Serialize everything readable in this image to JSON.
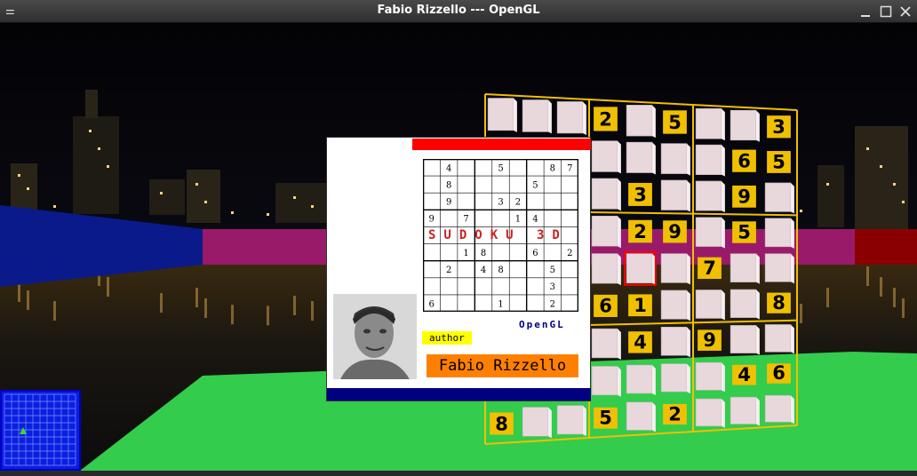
{
  "window": {
    "title": "Fabio Rizzello --- OpenGL",
    "menu_icon": "menu-icon",
    "controls": [
      "minimize-icon",
      "maximize-icon",
      "close-icon"
    ]
  },
  "splash": {
    "sudoku_title": "SUDOKU 3D",
    "opengl_label": "OpenGL",
    "author_label": "author",
    "author_name": "Fabio Rizzello",
    "grid": [
      [
        "",
        "4",
        "",
        "",
        "5",
        "",
        "",
        "8",
        "7"
      ],
      [
        "",
        "8",
        "",
        "",
        "",
        "",
        "5",
        "",
        ""
      ],
      [
        "",
        "9",
        "",
        "",
        "3",
        "2",
        "",
        "",
        ""
      ],
      [
        "9",
        "",
        "7",
        "",
        "",
        "1",
        "4",
        "",
        ""
      ],
      [
        "",
        "",
        "",
        "",
        "",
        "",
        "",
        "",
        ""
      ],
      [
        "",
        "",
        "1",
        "8",
        "",
        "",
        "6",
        "",
        "2"
      ],
      [
        "",
        "2",
        "",
        "4",
        "8",
        "",
        "",
        "5",
        ""
      ],
      [
        "",
        "",
        "",
        "",
        "",
        "",
        "",
        "3",
        ""
      ],
      [
        "6",
        "",
        "",
        "",
        "1",
        "",
        "",
        "2",
        ""
      ]
    ]
  },
  "board": {
    "rows": [
      [
        "",
        "",
        "",
        "2",
        "",
        "5",
        "",
        "",
        "3"
      ],
      [
        "",
        "",
        "",
        "",
        "",
        "",
        "",
        "6",
        "5"
      ],
      [
        "",
        "",
        "",
        "",
        "3",
        "",
        "",
        "9",
        ""
      ],
      [
        "",
        "",
        "",
        "",
        "2",
        "9",
        "",
        "5",
        ""
      ],
      [
        "",
        "",
        "",
        "",
        "",
        "",
        "7",
        "",
        ""
      ],
      [
        "",
        "",
        "",
        "6",
        "1",
        "",
        "",
        "",
        "8"
      ],
      [
        "",
        "",
        "",
        "",
        "4",
        "",
        "9",
        "",
        ""
      ],
      [
        "",
        "",
        "",
        "",
        "",
        "",
        "",
        "4",
        "6"
      ],
      [
        "8",
        "",
        "",
        "5",
        "",
        "2",
        "",
        "",
        ""
      ]
    ],
    "selected_cell": [
      4,
      4
    ],
    "colors": {
      "frame": "#f0c000",
      "number_bg": "#f0c000",
      "cell": "#e8d8dc",
      "selection": "#ff0000"
    }
  },
  "scene": {
    "floor_color": "#33cc4c",
    "wall_left_color": "#0a1a8a",
    "wall_mid_color": "#9a1a6a",
    "wall_right_color": "#8a0000"
  },
  "minimap": {
    "player_icon": "player-arrow-icon"
  }
}
